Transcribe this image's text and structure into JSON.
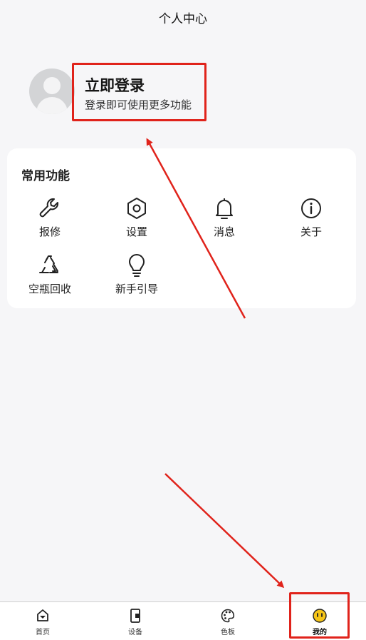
{
  "header": {
    "title": "个人中心"
  },
  "profile": {
    "login_title": "立即登录",
    "login_subtitle": "登录即可使用更多功能"
  },
  "functions": {
    "title": "常用功能",
    "items": [
      {
        "label": "报修",
        "icon": "wrench-icon"
      },
      {
        "label": "设置",
        "icon": "hexagon-settings-icon"
      },
      {
        "label": "消息",
        "icon": "bell-icon"
      },
      {
        "label": "关于",
        "icon": "info-icon"
      },
      {
        "label": "空瓶回收",
        "icon": "recycle-icon"
      },
      {
        "label": "新手引导",
        "icon": "lightbulb-icon"
      }
    ]
  },
  "tabbar": {
    "items": [
      {
        "label": "首页",
        "icon": "home-icon"
      },
      {
        "label": "设备",
        "icon": "device-icon"
      },
      {
        "label": "色板",
        "icon": "palette-icon"
      },
      {
        "label": "我的",
        "icon": "smiley-icon",
        "active": true
      }
    ]
  },
  "colors": {
    "highlight": "#e0231b",
    "active_tab": "#f5c518"
  }
}
